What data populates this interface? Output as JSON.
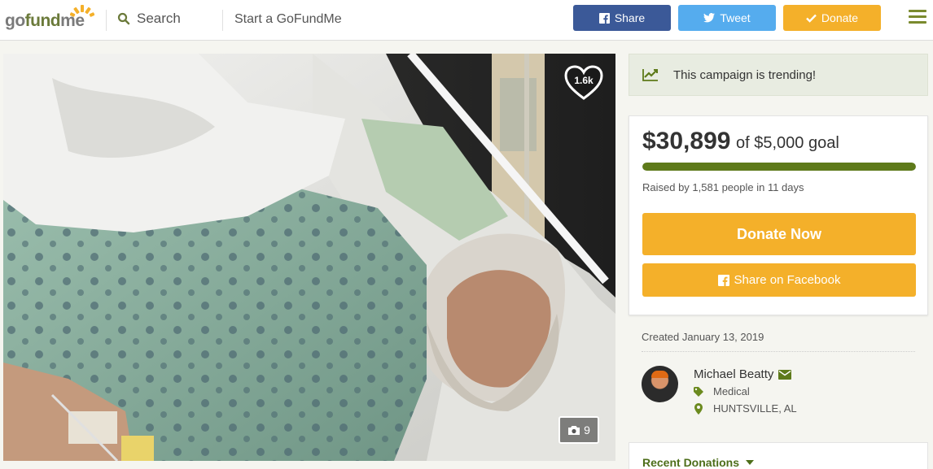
{
  "header": {
    "logo_part1": "go",
    "logo_part2": "fund",
    "logo_part3": "me",
    "search_label": "Search",
    "start_label": "Start a GoFundMe",
    "share_label": "Share",
    "tweet_label": "Tweet",
    "donate_label": "Donate"
  },
  "photo": {
    "likes": "1.6k",
    "photo_count": "9"
  },
  "trending": {
    "text": "This campaign is trending!"
  },
  "campaign": {
    "raised": "$30,899",
    "goal_text": "of $5,000 goal",
    "progress_percent": 100,
    "raised_by": "Raised by 1,581 people in 11 days",
    "donate_now_label": "Donate Now",
    "share_facebook_label": "Share on Facebook"
  },
  "details": {
    "created": "Created January 13, 2019",
    "organizer": "Michael Beatty",
    "category": "Medical",
    "location": "HUNTSVILLE, AL"
  },
  "recent": {
    "label": "Recent Donations"
  },
  "colors": {
    "facebook": "#3b5998",
    "twitter": "#55acee",
    "donate": "#f4b02a",
    "progress": "#5e7a1a",
    "brand_green": "#6b7a3a"
  }
}
